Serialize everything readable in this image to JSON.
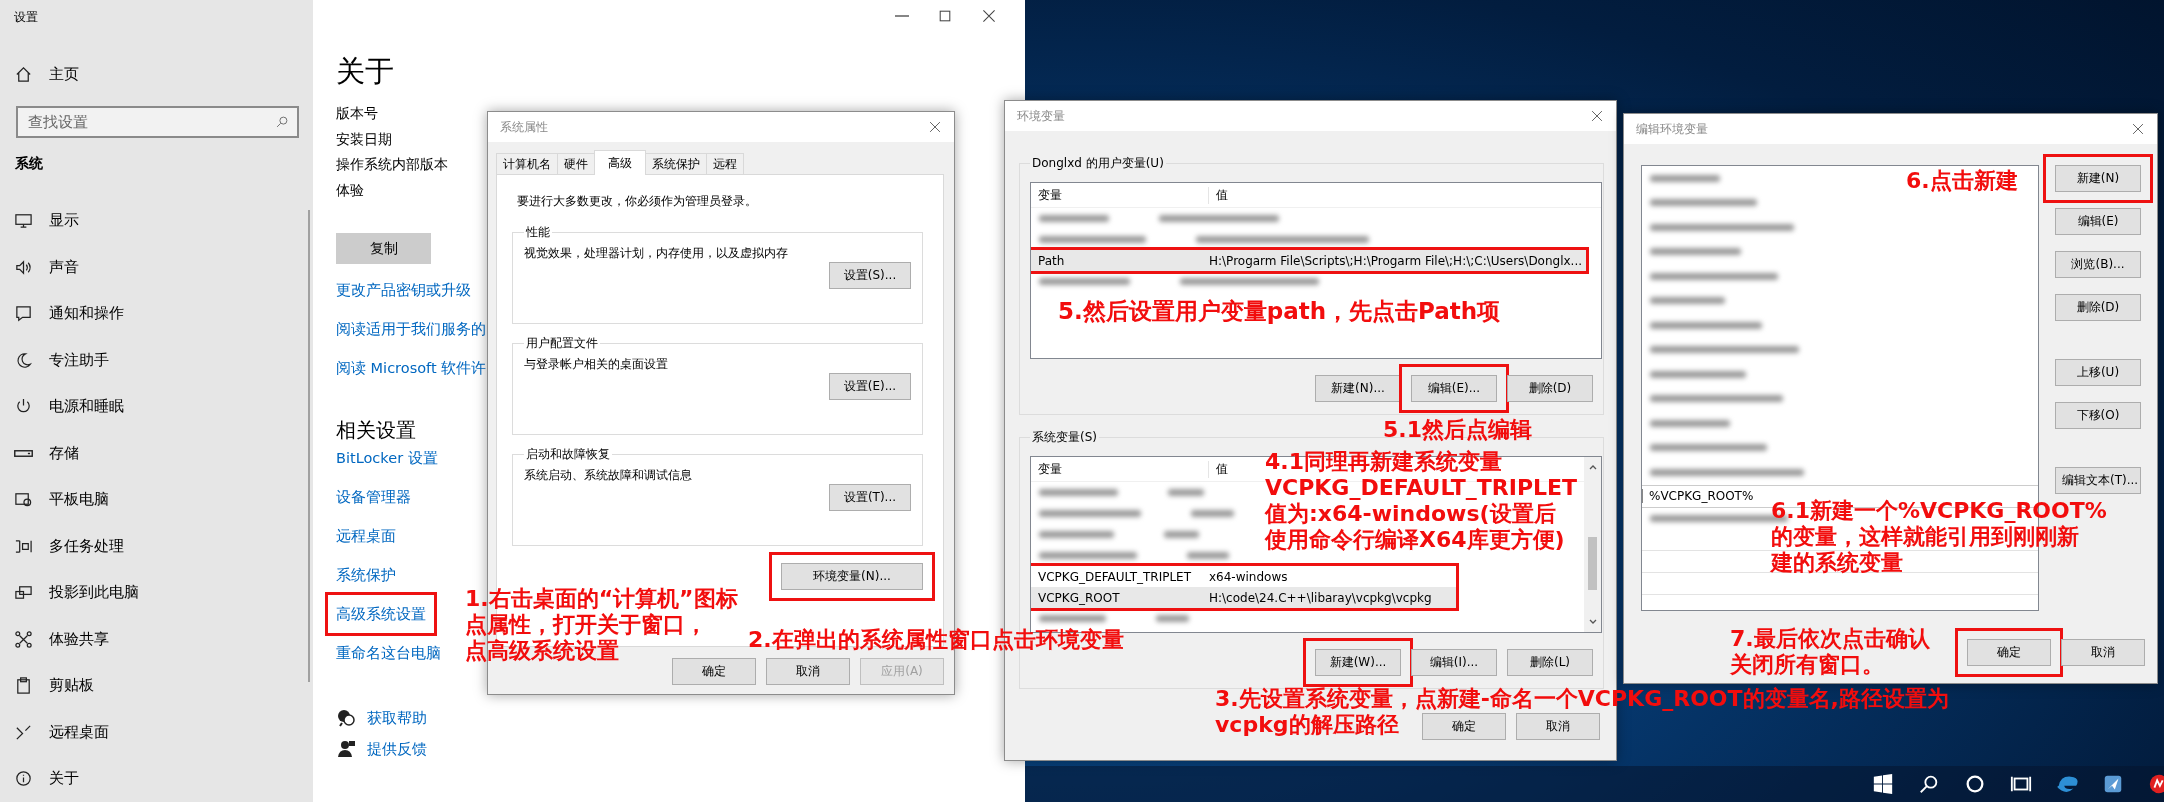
{
  "settings": {
    "title": "设置",
    "home": "主页",
    "search_placeholder": "查找设置",
    "section": "系统",
    "nav_items": [
      {
        "label": "显示"
      },
      {
        "label": "声音"
      },
      {
        "label": "通知和操作"
      },
      {
        "label": "专注助手"
      },
      {
        "label": "电源和睡眠"
      },
      {
        "label": "存储"
      },
      {
        "label": "平板电脑"
      },
      {
        "label": "多任务处理"
      },
      {
        "label": "投影到此电脑"
      },
      {
        "label": "体验共享"
      },
      {
        "label": "剪贴板"
      },
      {
        "label": "远程桌面"
      },
      {
        "label": "关于"
      }
    ],
    "about": {
      "title": "关于",
      "spec_labels": [
        "版本号",
        "安装日期",
        "操作系统内部版本",
        "体验"
      ],
      "copy_button": "复制",
      "links": [
        "更改产品密钥或升级",
        "阅读适用于我们服务的",
        "阅读 Microsoft 软件许"
      ],
      "related_title": "相关设置",
      "related_links": [
        {
          "label": "BitLocker 设置",
          "highlighted": false
        },
        {
          "label": "设备管理器",
          "highlighted": false
        },
        {
          "label": "远程桌面",
          "highlighted": false
        },
        {
          "label": "系统保护",
          "highlighted": false
        },
        {
          "label": "高级系统设置",
          "highlighted": true
        },
        {
          "label": "重命名这台电脑",
          "highlighted": false
        }
      ],
      "help_links": [
        "获取帮助",
        "提供反馈"
      ]
    }
  },
  "system_properties": {
    "title": "系统属性",
    "tabs": [
      {
        "label": "计算机名",
        "selected": false
      },
      {
        "label": "硬件",
        "selected": false
      },
      {
        "label": "高级",
        "selected": true
      },
      {
        "label": "系统保护",
        "selected": false
      },
      {
        "label": "远程",
        "selected": false
      }
    ],
    "notice": "要进行大多数更改，你必须作为管理员登录。",
    "groups": [
      {
        "title": "性能",
        "description": "视觉效果，处理器计划，内存使用，以及虚拟内存",
        "button": "设置(S)..."
      },
      {
        "title": "用户配置文件",
        "description": "与登录帐户相关的桌面设置",
        "button": "设置(E)..."
      },
      {
        "title": "启动和故障恢复",
        "description": "系统启动、系统故障和调试信息",
        "button": "设置(T)..."
      }
    ],
    "env_button": {
      "label": "环境变量(N)...",
      "highlighted": true
    },
    "buttons": [
      {
        "label": "确定",
        "disabled": false
      },
      {
        "label": "取消",
        "disabled": false
      },
      {
        "label": "应用(A)",
        "disabled": true
      }
    ]
  },
  "environment_variables": {
    "title": "环境变量",
    "user_group": {
      "title": "Donglxd 的用户变量(U)",
      "columns": [
        "变量",
        "值"
      ],
      "rows": [
        {
          "kind": "blurred",
          "selected": false,
          "highlighted": false
        },
        {
          "kind": "blurred",
          "selected": false,
          "highlighted": false
        },
        {
          "kind": "text",
          "name": "Path",
          "value": "H:\\Progarm File\\Scripts\\;H:\\Progarm File\\;H:\\;C:\\Users\\Donglx...",
          "selected": true,
          "highlighted": true
        },
        {
          "kind": "blurred",
          "selected": false,
          "highlighted": false
        }
      ],
      "buttons": [
        {
          "label": "新建(N)...",
          "highlighted": false
        },
        {
          "label": "编辑(E)...",
          "highlighted": true
        },
        {
          "label": "删除(D)",
          "highlighted": false
        }
      ]
    },
    "system_group": {
      "title": "系统变量(S)",
      "columns": [
        "变量",
        "值"
      ],
      "rows": [
        {
          "kind": "blurred",
          "selected": false,
          "highlighted": false
        },
        {
          "kind": "blurred",
          "selected": false,
          "highlighted": false
        },
        {
          "kind": "blurred",
          "selected": false,
          "highlighted": false
        },
        {
          "kind": "blurred",
          "selected": false,
          "highlighted": false
        },
        {
          "kind": "text",
          "name": "VCPKG_DEFAULT_TRIPLET",
          "value": "x64-windows",
          "selected": false,
          "highlighted": true
        },
        {
          "kind": "text",
          "name": "VCPKG_ROOT",
          "value": "H:\\code\\24.C++\\libaray\\vcpkg\\vcpkg",
          "selected": true,
          "highlighted": true
        },
        {
          "kind": "blurred",
          "selected": false,
          "highlighted": false
        }
      ],
      "buttons": [
        {
          "label": "新建(W)...",
          "highlighted": true
        },
        {
          "label": "编辑(I)...",
          "highlighted": false
        },
        {
          "label": "删除(L)",
          "highlighted": false
        }
      ]
    },
    "buttons": [
      {
        "label": "确定"
      },
      {
        "label": "取消"
      }
    ]
  },
  "edit_variable": {
    "title": "编辑环境变量",
    "rows": [
      {
        "kind": "blurred"
      },
      {
        "kind": "blurred"
      },
      {
        "kind": "blurred"
      },
      {
        "kind": "blurred"
      },
      {
        "kind": "blurred"
      },
      {
        "kind": "blurred"
      },
      {
        "kind": "blurred"
      },
      {
        "kind": "blurred"
      },
      {
        "kind": "blurred"
      },
      {
        "kind": "blurred"
      },
      {
        "kind": "blurred"
      },
      {
        "kind": "blurred"
      },
      {
        "kind": "blurred"
      },
      {
        "kind": "editing",
        "value": "%VCPKG_ROOT%"
      },
      {
        "kind": "blurred"
      },
      {
        "kind": "empty"
      },
      {
        "kind": "empty"
      },
      {
        "kind": "empty"
      }
    ],
    "buttons": [
      {
        "label": "新建(N)",
        "highlighted": true
      },
      {
        "label": "编辑(E)",
        "highlighted": false
      },
      {
        "label": "浏览(B)...",
        "highlighted": false
      },
      {
        "label": "删除(D)",
        "highlighted": false
      },
      {
        "label": "上移(U)",
        "highlighted": false
      },
      {
        "label": "下移(O)",
        "highlighted": false
      },
      {
        "label": "编辑文本(T)...",
        "highlighted": false
      }
    ],
    "footer_buttons": [
      {
        "label": "确定",
        "highlighted": true
      },
      {
        "label": "取消",
        "highlighted": false
      }
    ]
  },
  "annotations": [
    {
      "lines": [
        "1.右击桌面的“计算机”图标",
        "点属性，打开关于窗口，",
        "点高级系统设置"
      ]
    },
    {
      "lines": [
        "2.在弹出的系统属性窗口点击环境变量"
      ]
    },
    {
      "lines": [
        "5.然后设置用户变量path，先点击Path项"
      ]
    },
    {
      "lines": [
        "5.1然后点编辑"
      ]
    },
    {
      "lines": [
        "4.1同理再新建系统变量",
        "VCPKG_DEFAULT_TRIPLET",
        "值为:x64-windows(设置后",
        "使用命令行编译X64库更方便)"
      ]
    },
    {
      "lines": [
        "3.先设置系统变量，点新建-命名一个VCPKG_ROOT的变量名,路径设置为",
        "vcpkg的解压路径"
      ]
    },
    {
      "lines": [
        "6.点击新建"
      ]
    },
    {
      "lines": [
        "6.1新建一个%VCPKG_ROOT%",
        "的变量，这样就能引用到刚刚新",
        "建的系统变量"
      ]
    },
    {
      "lines": [
        "7.最后依次点击确认",
        "关闭所有窗口。"
      ]
    }
  ]
}
